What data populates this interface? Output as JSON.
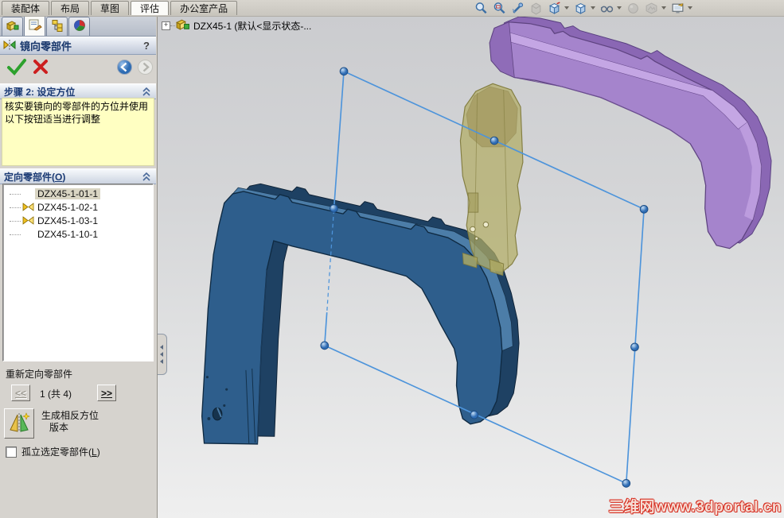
{
  "command_tabs": {
    "items": [
      {
        "label": "装配体"
      },
      {
        "label": "布局"
      },
      {
        "label": "草图"
      },
      {
        "label": "评估"
      },
      {
        "label": "办公室产品"
      }
    ],
    "active": "评估"
  },
  "headsup_toolbar": {
    "icons": [
      "zoom-to-fit",
      "zoom-to-area",
      "previous-view",
      "section-view",
      "view-orientation",
      "display-style",
      "hide-show-items",
      "edit-appearance",
      "apply-scene",
      "view-settings"
    ]
  },
  "panel": {
    "title": "镜向零部件",
    "help_label": "?",
    "step_header": "步骤 2: 设定方位",
    "step_message_line1": "核实要镜向的零部件的方位并使用",
    "step_message_line2": "以下按钮适当进行调整",
    "orient_pre": "定向零部件(",
    "orient_key": "O",
    "orient_post": ")",
    "components": [
      {
        "name": "DZX45-1-01-1",
        "warning": false,
        "selected": true
      },
      {
        "name": "DZX45-1-02-1",
        "warning": true,
        "selected": false
      },
      {
        "name": "DZX45-1-03-1",
        "warning": true,
        "selected": false
      },
      {
        "name": "DZX45-1-10-1",
        "warning": false,
        "selected": false
      }
    ],
    "reorient_label": "重新定向零部件",
    "prev_label": "<<",
    "next_label": ">>",
    "counter": "1 (共 4)",
    "opposite_line1": "生成相反方位",
    "opposite_line2": "版本",
    "isolate_pre": "孤立选定零部件(",
    "isolate_key": "L",
    "isolate_post": ")"
  },
  "viewport": {
    "tree_item": "DZX45-1 (默认<显示状态-...",
    "watermark": "三维网www.3dportal.cn"
  },
  "colors": {
    "selection_blue": "#4d94db",
    "part_blue": "#2e5e8c",
    "part_purple": "#a584cc",
    "part_yellow_transparent": "#b2ac64",
    "message_yellow": "#ffffc2",
    "watermark_red": "#d62b1e"
  }
}
